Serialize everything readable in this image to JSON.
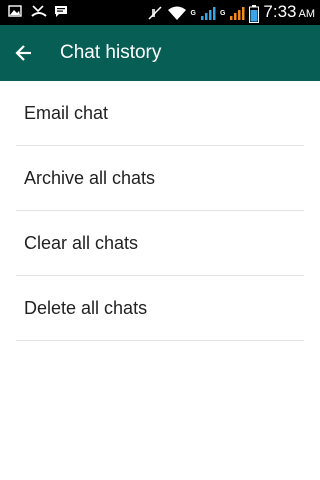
{
  "status_bar": {
    "time": "7:33",
    "ampm": "AM",
    "network_label_1": "G",
    "network_label_2": "G",
    "icons": [
      "image-icon",
      "missed-call-icon",
      "message-icon",
      "mute-icon",
      "wifi-icon",
      "signal-icon",
      "signal-icon",
      "battery-icon"
    ]
  },
  "app_bar": {
    "title": "Chat history",
    "back_icon": "arrow-left-icon",
    "color": "#075e54"
  },
  "menu": {
    "items": [
      {
        "label": "Email chat"
      },
      {
        "label": "Archive all chats"
      },
      {
        "label": "Clear all chats"
      },
      {
        "label": "Delete all chats"
      }
    ]
  }
}
